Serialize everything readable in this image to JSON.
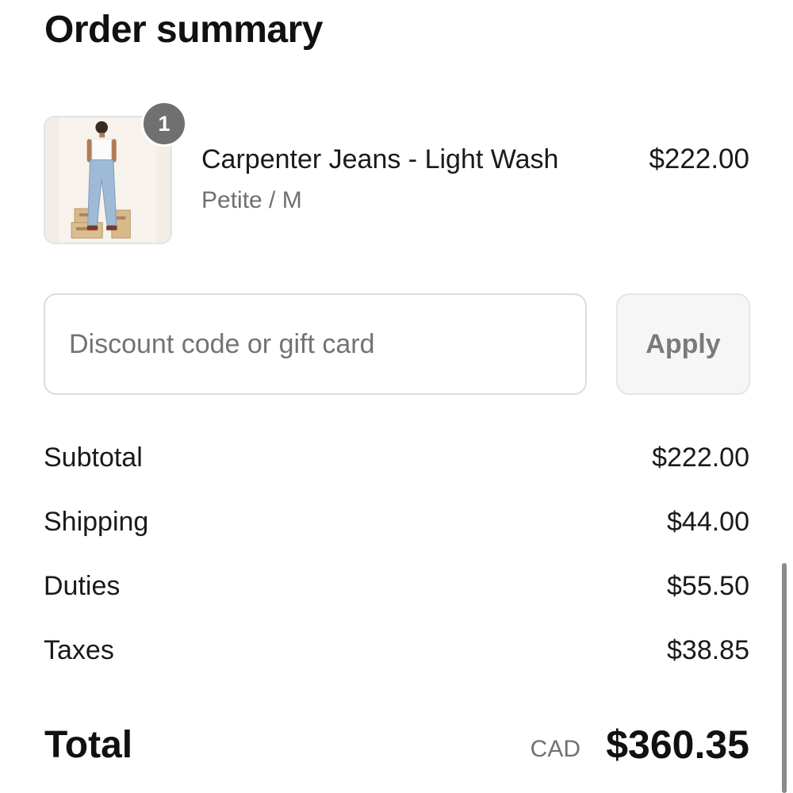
{
  "header": {
    "title": "Order summary"
  },
  "line_item": {
    "quantity": "1",
    "name": "Carpenter Jeans - Light Wash",
    "variant": "Petite / M",
    "price": "$222.00"
  },
  "discount": {
    "placeholder": "Discount code or gift card",
    "value": "",
    "apply_label": "Apply"
  },
  "summary": {
    "subtotal": {
      "label": "Subtotal",
      "value": "$222.00"
    },
    "shipping": {
      "label": "Shipping",
      "value": "$44.00"
    },
    "duties": {
      "label": "Duties",
      "value": "$55.50"
    },
    "taxes": {
      "label": "Taxes",
      "value": "$38.85"
    }
  },
  "total": {
    "label": "Total",
    "currency": "CAD",
    "amount": "$360.35"
  }
}
